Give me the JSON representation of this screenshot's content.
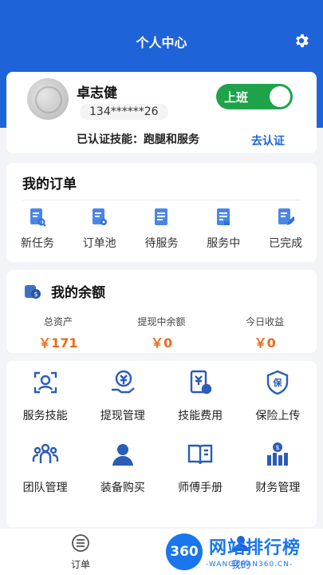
{
  "header": {
    "title": "个人中心"
  },
  "profile": {
    "name": "卓志健",
    "phone": "134******26",
    "skills_label": "已认证技能：跑腿和服务",
    "certify_link": "去认证",
    "status_toggle": "上班"
  },
  "orders": {
    "title": "我的订单",
    "items": [
      {
        "label": "新任务",
        "icon": "doc-search-icon"
      },
      {
        "label": "订单池",
        "icon": "doc-gear-icon"
      },
      {
        "label": "待服务",
        "icon": "doc-list-icon"
      },
      {
        "label": "服务中",
        "icon": "doc-pending-icon"
      },
      {
        "label": "已完成",
        "icon": "doc-edit-icon"
      }
    ]
  },
  "balance": {
    "title": "我的余额",
    "items": [
      {
        "label": "总资产",
        "value": "￥171"
      },
      {
        "label": "提现中余额",
        "value": "￥0"
      },
      {
        "label": "今日收益",
        "value": "￥0"
      }
    ]
  },
  "services": {
    "items": [
      {
        "label": "服务技能",
        "icon": "face-scan-icon"
      },
      {
        "label": "提现管理",
        "icon": "coin-hand-icon"
      },
      {
        "label": "技能费用",
        "icon": "yen-doc-icon"
      },
      {
        "label": "保险上传",
        "icon": "shield-icon"
      },
      {
        "label": "团队管理",
        "icon": "team-icon"
      },
      {
        "label": "装备购买",
        "icon": "user-icon"
      },
      {
        "label": "师傅手册",
        "icon": "book-icon"
      },
      {
        "label": "财务管理",
        "icon": "finance-icon"
      }
    ]
  },
  "nav": {
    "tabs": [
      {
        "label": "订单",
        "icon": "list-icon"
      },
      {
        "label": "我的",
        "icon": "person-icon"
      }
    ]
  },
  "watermark": {
    "logo": "360",
    "text": "网站排行榜",
    "sub": "-WANGZHAN360.CN-"
  },
  "colors": {
    "primary": "#1f63d8",
    "accent": "#ee6b1a",
    "toggle": "#1fa34a"
  }
}
